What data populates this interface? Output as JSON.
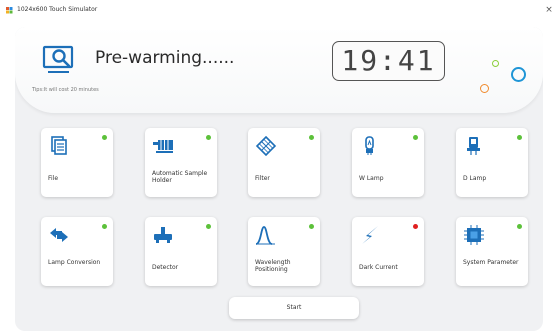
{
  "window": {
    "title": "1024x600 Touch Simulator",
    "close_label": "×"
  },
  "status": {
    "text": "Pre-warming......",
    "tip": "Tips:It will cost 20 minutes",
    "time": "19:41"
  },
  "colors": {
    "accent": "#1d6fb8",
    "ok": "#5cc13a",
    "error": "#e02020",
    "deco_green": "#8ccf3a",
    "deco_orange": "#f08a2c",
    "deco_blue": "#1f95d6"
  },
  "tiles": [
    {
      "label": "File",
      "icon": "file-icon",
      "status": "ok"
    },
    {
      "label": "Automatic Sample Holder",
      "icon": "sample-holder-icon",
      "status": "ok"
    },
    {
      "label": "Filter",
      "icon": "filter-icon",
      "status": "ok"
    },
    {
      "label": "W Lamp",
      "icon": "w-lamp-icon",
      "status": "ok"
    },
    {
      "label": "D Lamp",
      "icon": "d-lamp-icon",
      "status": "ok"
    },
    {
      "label": "Lamp Conversion",
      "icon": "lamp-conversion-icon",
      "status": "ok"
    },
    {
      "label": "Detector",
      "icon": "detector-icon",
      "status": "ok"
    },
    {
      "label": "Wavelength Positioning",
      "icon": "wavelength-icon",
      "status": "ok"
    },
    {
      "label": "Dark Current",
      "icon": "dark-current-icon",
      "status": "error"
    },
    {
      "label": "System Parameter",
      "icon": "system-parameter-icon",
      "status": "ok"
    }
  ],
  "start": {
    "label": "Start"
  }
}
